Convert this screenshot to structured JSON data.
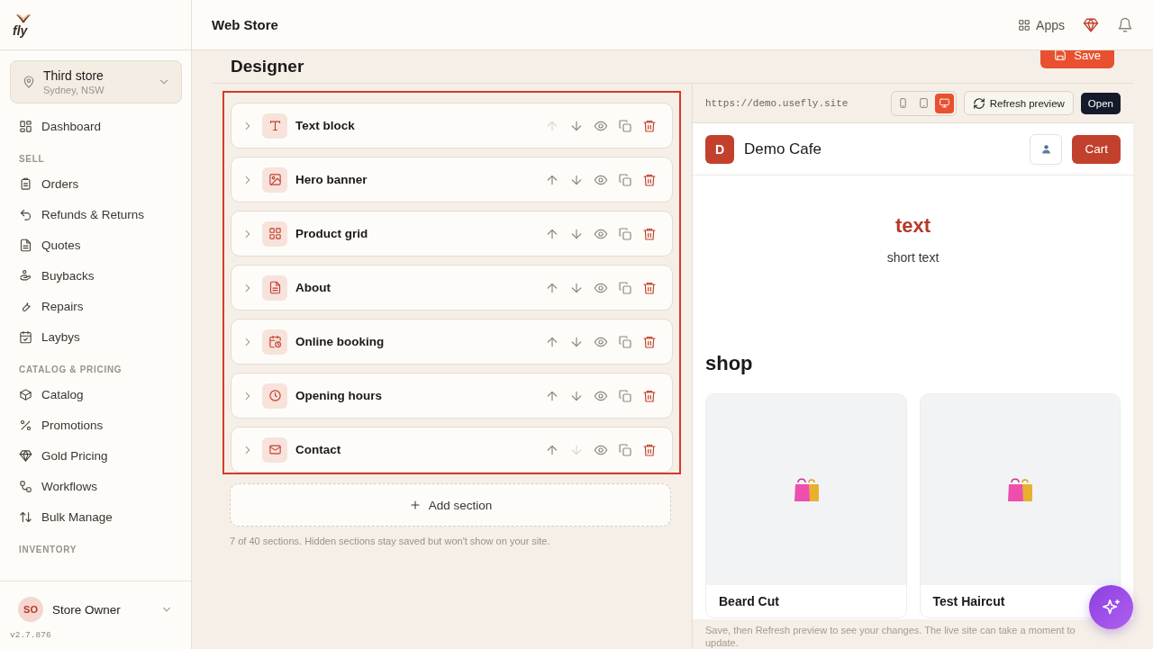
{
  "app": {
    "logo": "fly",
    "version": "v2.7.876"
  },
  "topbar": {
    "title": "Web Store",
    "apps_label": "Apps"
  },
  "store_switcher": {
    "name": "Third store",
    "location": "Sydney, NSW"
  },
  "sidebar": {
    "groups": [
      {
        "items": [
          {
            "label": "Dashboard"
          }
        ]
      },
      {
        "heading": "SELL",
        "items": [
          {
            "label": "Orders"
          },
          {
            "label": "Refunds & Returns"
          },
          {
            "label": "Quotes"
          },
          {
            "label": "Buybacks"
          },
          {
            "label": "Repairs"
          },
          {
            "label": "Laybys"
          }
        ]
      },
      {
        "heading": "CATALOG & PRICING",
        "items": [
          {
            "label": "Catalog"
          },
          {
            "label": "Promotions"
          },
          {
            "label": "Gold Pricing"
          },
          {
            "label": "Workflows"
          },
          {
            "label": "Bulk Manage"
          }
        ]
      },
      {
        "heading": "INVENTORY"
      }
    ]
  },
  "user": {
    "initials": "SO",
    "name": "Store Owner"
  },
  "page": {
    "title": "Designer",
    "save_label": "Save"
  },
  "sections": [
    {
      "kind": "text",
      "title": "Text block",
      "up_disabled": true,
      "down_disabled": false
    },
    {
      "kind": "hero",
      "title": "Hero banner",
      "up_disabled": false,
      "down_disabled": false
    },
    {
      "kind": "grid",
      "title": "Product grid",
      "up_disabled": false,
      "down_disabled": false
    },
    {
      "kind": "about",
      "title": "About",
      "up_disabled": false,
      "down_disabled": false
    },
    {
      "kind": "booking",
      "title": "Online booking",
      "up_disabled": false,
      "down_disabled": false
    },
    {
      "kind": "hours",
      "title": "Opening hours",
      "up_disabled": false,
      "down_disabled": false
    },
    {
      "kind": "contact",
      "title": "Contact",
      "up_disabled": false,
      "down_disabled": true
    }
  ],
  "add_section_label": "Add section",
  "sections_note": "7 of 40 sections. Hidden sections stay saved but won't show on your site.",
  "preview": {
    "url": "https://demo.usefly.site",
    "devices": [
      {
        "kind": "phone",
        "selected": false
      },
      {
        "kind": "tablet",
        "selected": false
      },
      {
        "kind": "desktop",
        "selected": true
      }
    ],
    "refresh_label": "Refresh preview",
    "open_label": "Open",
    "site": {
      "logo_letter": "D",
      "name": "Demo Cafe",
      "cart_label": "Cart",
      "hero_title": "text",
      "hero_subtitle": "short text",
      "shop_title": "shop",
      "products": [
        {
          "name": "Beard Cut"
        },
        {
          "name": "Test Haircut"
        }
      ]
    },
    "note": "Save, then Refresh preview to see your changes. The live site can take a moment to update."
  }
}
